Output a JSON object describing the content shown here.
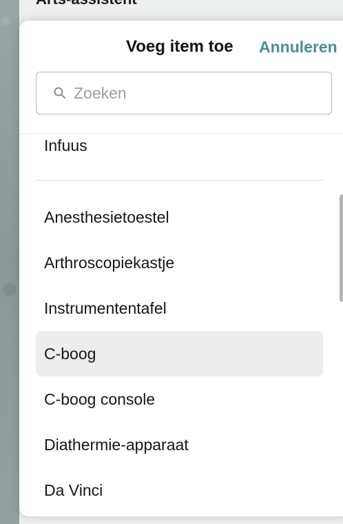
{
  "background": {
    "title": "Arts-assistent"
  },
  "sheet": {
    "title": "Voeg item toe",
    "cancel_label": "Annuleren"
  },
  "search": {
    "placeholder": "Zoeken",
    "value": "",
    "icon": "search-icon"
  },
  "items_pinned": [
    {
      "label": "Infuus"
    }
  ],
  "items": [
    {
      "label": "Anesthesietoestel",
      "selected": false
    },
    {
      "label": "Arthroscopiekastje",
      "selected": false
    },
    {
      "label": "Instrumententafel",
      "selected": false
    },
    {
      "label": "C-boog",
      "selected": true
    },
    {
      "label": "C-boog console",
      "selected": false
    },
    {
      "label": "Diathermie-apparaat",
      "selected": false
    },
    {
      "label": "Da Vinci",
      "selected": false
    }
  ],
  "colors": {
    "accent": "#4a8f8b",
    "selected_background": "#ededed"
  }
}
